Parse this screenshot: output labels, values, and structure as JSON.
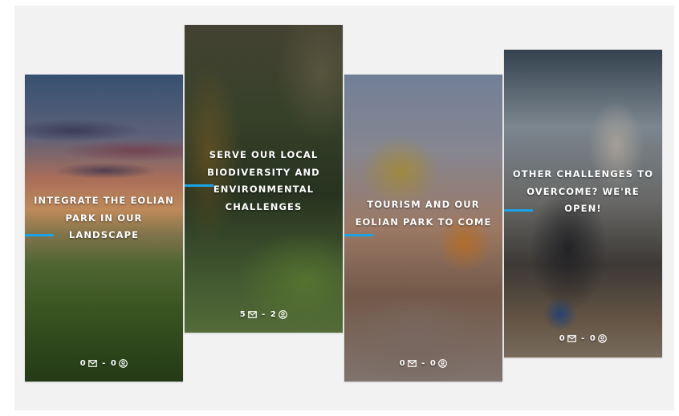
{
  "cards": [
    {
      "title": "INTEGRATE THE EOLIAN PARK IN OUR LANDSCAPE",
      "messages": "0",
      "participants": "0"
    },
    {
      "title": "SERVE OUR LOCAL BIODIVERSITY AND ENVIRONMENTAL CHALLENGES",
      "messages": "5",
      "participants": "2"
    },
    {
      "title": "TOURISM AND OUR EOLIAN PARK TO COME",
      "messages": "0",
      "participants": "0"
    },
    {
      "title": "OTHER CHALLENGES TO OVERCOME? WE'RE OPEN!",
      "messages": "0",
      "participants": "0"
    }
  ],
  "stats_separator": "-",
  "icons": {
    "messages": "envelope-icon",
    "participants": "user-circle-icon"
  },
  "colors": {
    "accent": "#1ba3e6",
    "text": "#ffffff",
    "background": "#f2f2f3"
  }
}
